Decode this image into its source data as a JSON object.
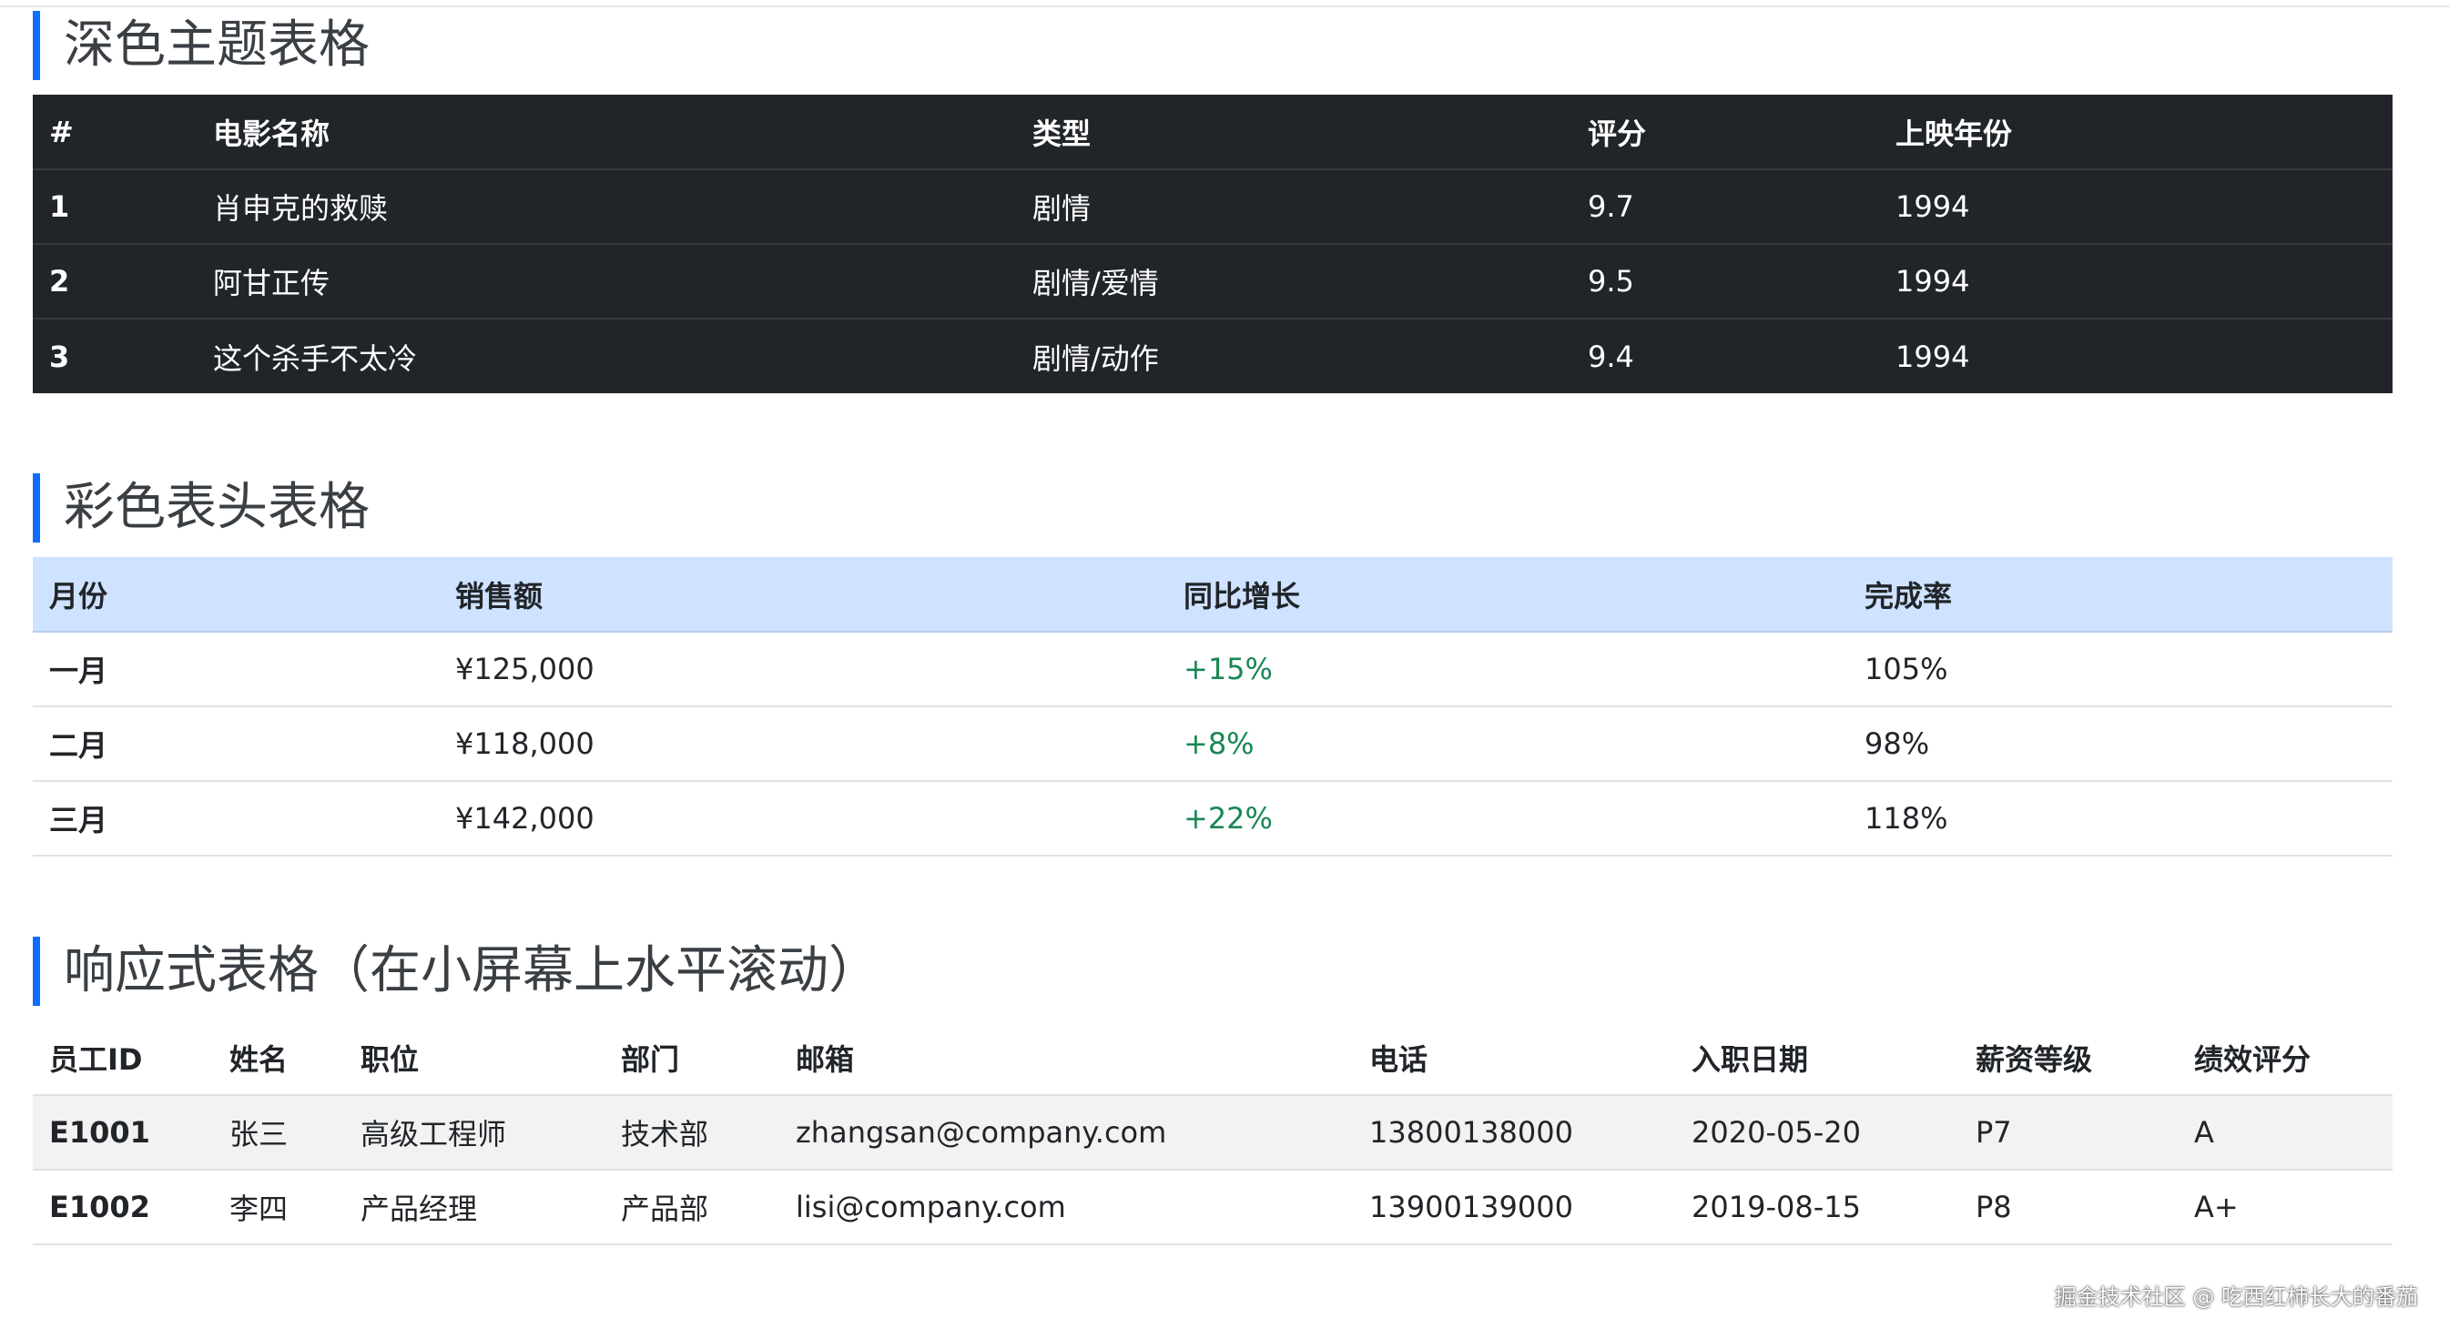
{
  "dark_table": {
    "title": "深色主题表格",
    "headers": [
      "#",
      "电影名称",
      "类型",
      "评分",
      "上映年份"
    ],
    "rows": [
      [
        "1",
        "肖申克的救赎",
        "剧情",
        "9.7",
        "1994"
      ],
      [
        "2",
        "阿甘正传",
        "剧情/爱情",
        "9.5",
        "1994"
      ],
      [
        "3",
        "这个杀手不太冷",
        "剧情/动作",
        "9.4",
        "1994"
      ]
    ]
  },
  "color_table": {
    "title": "彩色表头表格",
    "headers": [
      "月份",
      "销售额",
      "同比增长",
      "完成率"
    ],
    "rows": [
      [
        "一月",
        "¥125,000",
        "+15%",
        "105%"
      ],
      [
        "二月",
        "¥118,000",
        "+8%",
        "98%"
      ],
      [
        "三月",
        "¥142,000",
        "+22%",
        "118%"
      ]
    ]
  },
  "responsive_table": {
    "title": "响应式表格（在小屏幕上水平滚动）",
    "headers": [
      "员工ID",
      "姓名",
      "职位",
      "部门",
      "邮箱",
      "电话",
      "入职日期",
      "薪资等级",
      "绩效评分"
    ],
    "rows": [
      [
        "E1001",
        "张三",
        "高级工程师",
        "技术部",
        "zhangsan@company.com",
        "13800138000",
        "2020-05-20",
        "P7",
        "A"
      ],
      [
        "E1002",
        "李四",
        "产品经理",
        "产品部",
        "lisi@company.com",
        "13900139000",
        "2019-08-15",
        "P8",
        "A+"
      ]
    ]
  },
  "watermark": "掘金技术社区 @ 吃西红柿长大的番茄",
  "colors": {
    "accent": "#0d6efd",
    "dark_bg": "#212529",
    "header_tint": "#cfe2ff",
    "positive": "#198754"
  }
}
